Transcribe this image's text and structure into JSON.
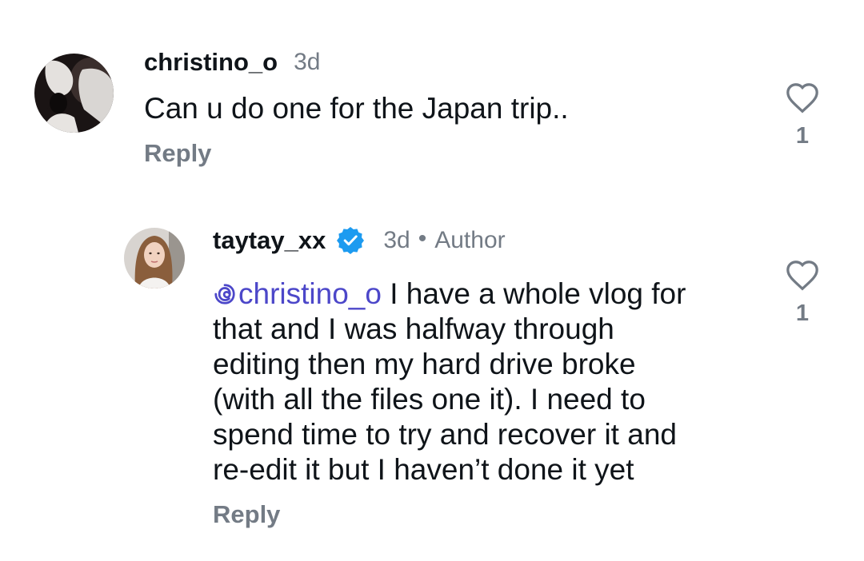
{
  "comments": [
    {
      "username": "christino_o",
      "time": "3d",
      "text": "Can u do one for the Japan trip..",
      "reply_label": "Reply",
      "likes": "1",
      "avatar_icon": "silhouette-avatar-icon"
    },
    {
      "username": "taytay_xx",
      "verified": true,
      "time": "3d",
      "dot": "•",
      "author_tag": "Author",
      "mention": "christino_o",
      "text_lines": [
        "I have a whole vlog for",
        "that and I was halfway through",
        "editing then my hard drive broke",
        "(with all the files one it). I need to",
        "spend time to try and recover it and",
        "re-edit it but I haven’t done it yet"
      ],
      "reply_label": "Reply",
      "likes": "1",
      "avatar_icon": "portrait-avatar-icon"
    }
  ],
  "colors": {
    "text": "#0f1419",
    "muted": "#737b85",
    "mention": "#4c47c9",
    "verified": "#1d9bf0"
  }
}
